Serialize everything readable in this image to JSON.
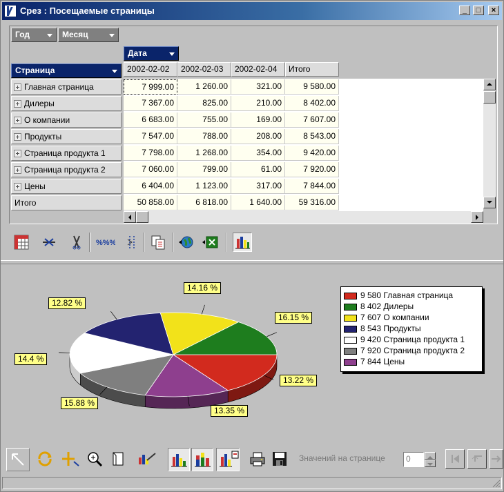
{
  "window": {
    "title": "Срез : Посещаемые страницы",
    "minimize": "_",
    "maximize": "□",
    "close": "×"
  },
  "pivot": {
    "filter_fields": [
      "Год",
      "Месяц"
    ],
    "column_field": "Дата",
    "row_field": "Страница",
    "columns": [
      "2002-02-02",
      "2002-02-03",
      "2002-02-04",
      "Итого"
    ],
    "rows": [
      {
        "label": "Главная страница",
        "values": [
          "7 999.00",
          "1 260.00",
          "321.00",
          "9 580.00"
        ]
      },
      {
        "label": "Дилеры",
        "values": [
          "7 367.00",
          "825.00",
          "210.00",
          "8 402.00"
        ]
      },
      {
        "label": "О компании",
        "values": [
          "6 683.00",
          "755.00",
          "169.00",
          "7 607.00"
        ]
      },
      {
        "label": "Продукты",
        "values": [
          "7 547.00",
          "788.00",
          "208.00",
          "8 543.00"
        ]
      },
      {
        "label": "Страница продукта 1",
        "values": [
          "7 798.00",
          "1 268.00",
          "354.00",
          "9 420.00"
        ]
      },
      {
        "label": "Страница продукта 2",
        "values": [
          "7 060.00",
          "799.00",
          "61.00",
          "7 920.00"
        ]
      },
      {
        "label": "Цены",
        "values": [
          "6 404.00",
          "1 123.00",
          "317.00",
          "7 844.00"
        ]
      }
    ],
    "total_row": {
      "label": "Итого",
      "values": [
        "50 858.00",
        "6 818.00",
        "1 640.00",
        "59 316.00"
      ]
    }
  },
  "chart_data": {
    "type": "pie",
    "labels": [
      "Главная страница",
      "Дилеры",
      "О компании",
      "Продукты",
      "Страница продукта 1",
      "Страница продукта 2",
      "Цены"
    ],
    "values": [
      9580,
      8402,
      7607,
      8543,
      9420,
      7920,
      7844
    ],
    "percent_labels": [
      "16.15 %",
      "14.16 %",
      "12.82 %",
      "14.4 %",
      "15.88 %",
      "13.35 %",
      "13.22 %"
    ],
    "legend_entries": [
      "9 580 Главная страница",
      "8 402 Дилеры",
      "7 607 О компании",
      "8 543 Продукты",
      "9 420 Страница продукта 1",
      "7 920 Страница продукта 2",
      "7 844 Цены"
    ],
    "colors": [
      "#d22a1e",
      "#1e7d1e",
      "#f2e21a",
      "#232370",
      "#ffffff",
      "#7f7f7f",
      "#8e3f8e"
    ],
    "legend_position": "right"
  },
  "bottom": {
    "rows_per_page_label": "Значений на странице",
    "rows_per_page_value": "0"
  }
}
